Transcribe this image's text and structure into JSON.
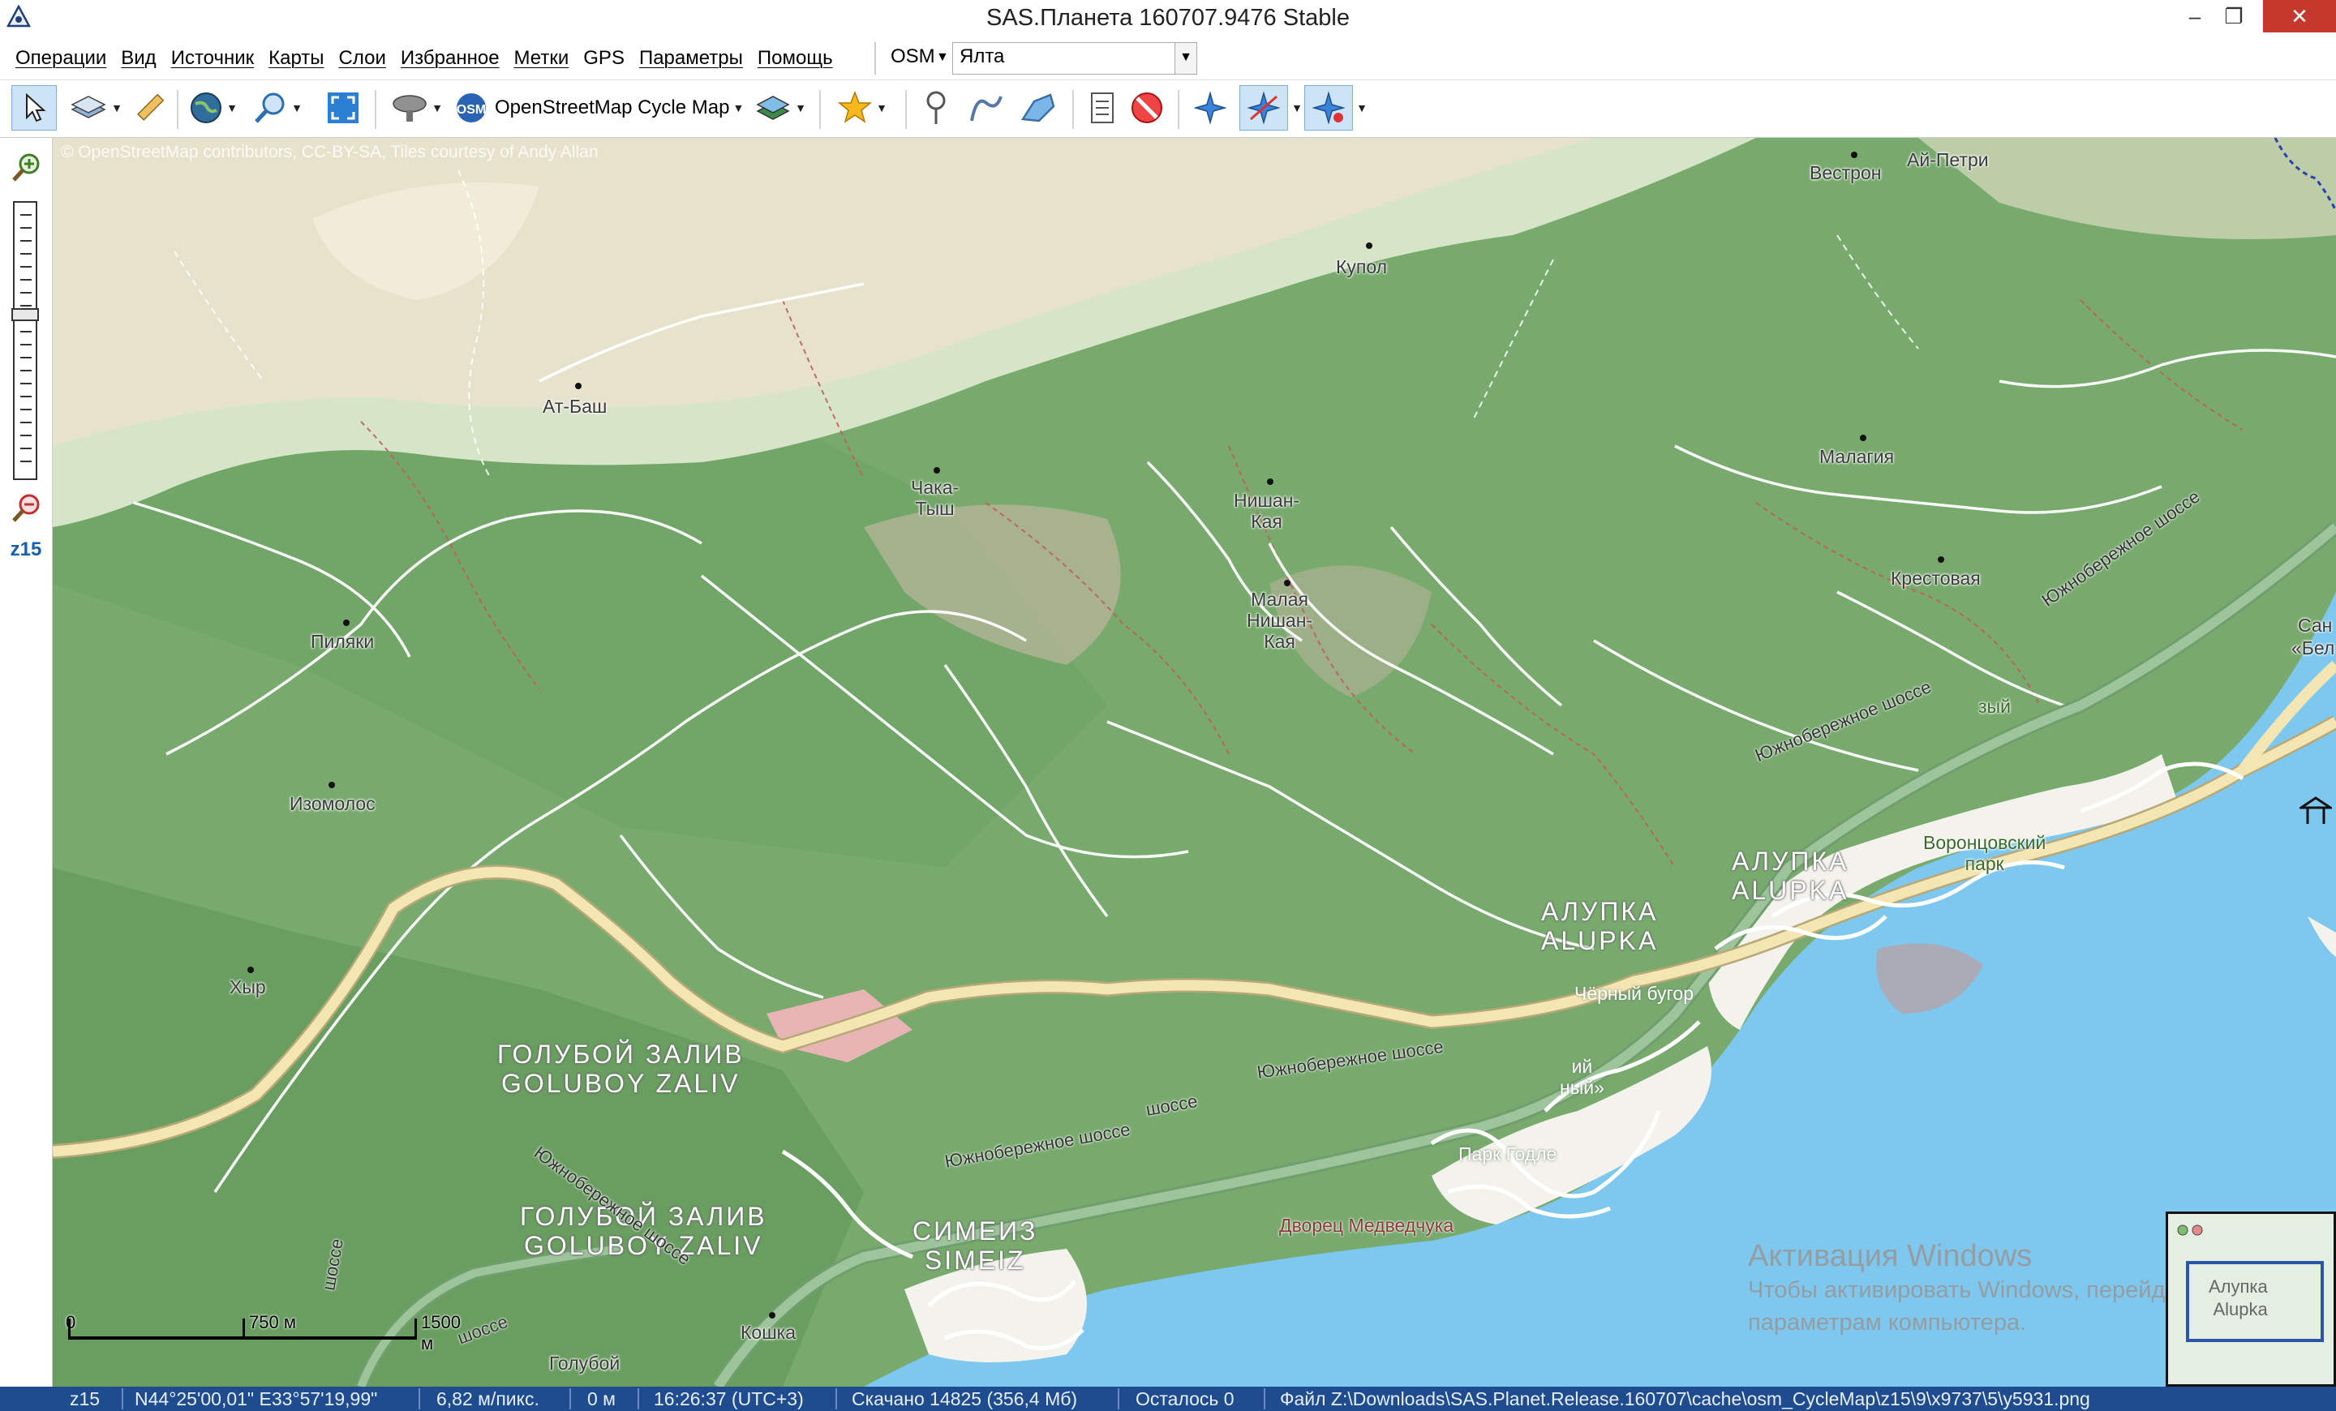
{
  "window": {
    "title": "SAS.Планета 160707.9476 Stable",
    "minimize": "–",
    "maximize": "❐",
    "close": "✕"
  },
  "menubar": {
    "items": [
      "Операции",
      "Вид",
      "Источник",
      "Карты",
      "Слои",
      "Избранное",
      "Метки",
      "GPS",
      "Параметры",
      "Помощь"
    ],
    "source_label": "OSM",
    "search_value": "Ялта"
  },
  "toolbar": {
    "map_name": "OpenStreetMap Cycle Map",
    "osm_badge": "OSM"
  },
  "sidebar": {
    "zoom_level": "z15"
  },
  "map": {
    "attribution": "© OpenStreetMap contributors, CC-BY-SA, Tiles courtesy of Andy Allan",
    "places": [
      "Вестрон",
      "Ай-Петри",
      "Купол",
      "Ат-Баш",
      "Чака-\nТыш",
      "Нишан-\nКая",
      "Малая\nНишан-\nКая",
      "Малагия",
      "Крестовая",
      "Пиляки",
      "Изомолос",
      "Хыр",
      "Кошка",
      "Голубой",
      "Сан",
      "«Бел",
      "зый",
      "Воронцовский\nпарк",
      "Чёрный бугор",
      "ий\nный»"
    ],
    "towns": [
      "АЛУПКА\nALUPKA",
      "АЛУПКА\nALUPKA",
      "ГОЛУБОЙ ЗАЛИВ\nGOLUBOY ZALIV",
      "ГОЛУБОЙ ЗАЛИВ\nGOLUBOY ZALIV",
      "СИМЕИЗ\nSIMEIZ"
    ],
    "road_labels": [
      "Южнобережное шоссе",
      "Южнобережное шоссе",
      "Южнобережное шоссе",
      "Южнобережное шоссе",
      "Южнобережное шоссе",
      "шоссе",
      "шоссе",
      "шоссе"
    ],
    "areas": [
      "Парк Годле",
      "Дворец Медведчука"
    ],
    "scale": {
      "zero": "0",
      "mid": "750 м",
      "end": "1500 м"
    },
    "watermark": {
      "heading": "Активация Windows",
      "line1": "Чтобы активировать Windows, перейдите к",
      "line2": "параметрам компьютера."
    },
    "minimap_label": "Алупка\nAlupka"
  },
  "statusbar": {
    "zoom": "z15",
    "coords": "N44°25'00,01\" E33°57'19,99\"",
    "resolution": "6,82 м/пикс.",
    "elevation": "0 м",
    "time": "16:26:37 (UTC+3)",
    "downloaded": "Скачано 14825 (356,4 Мб)",
    "remaining": "Осталось 0",
    "file": "Файл Z:\\Downloads\\SAS.Planet.Release.160707\\cache\\osm_CycleMap\\z15\\9\\x9737\\5\\y5931.png"
  },
  "colors": {
    "forest": "#75a86b",
    "ridge": "#e6e2cc",
    "sea": "#7ec8ef",
    "urban": "#f4f2ec",
    "major_road": "#f3e6b2",
    "highway": "#9dc49a",
    "path": "#c45a5a",
    "statusbar": "#1e4c8f"
  },
  "icons": [
    "select-arrow-icon",
    "layers-icon",
    "ruler-icon",
    "globe-icon",
    "zoom-tool-icon",
    "fullscreen-icon",
    "satellite-icon",
    "map-layers-icon",
    "favorites-star-icon",
    "marker-pin-icon",
    "path-icon",
    "polygon-icon",
    "marks-list-icon",
    "no-entry-icon",
    "gps-icon",
    "gps-track-icon",
    "gps-follow-icon"
  ]
}
